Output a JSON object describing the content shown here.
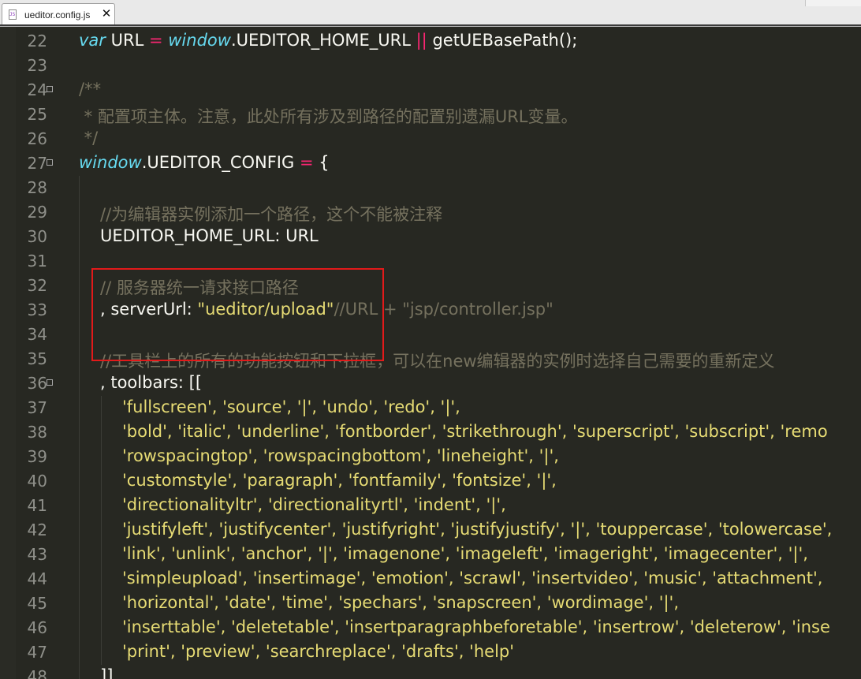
{
  "tab": {
    "title": "ueditor.config.js",
    "file_icon": "js-file-icon",
    "close_glyph": "✕"
  },
  "colors": {
    "background": "#272822",
    "keyword": "#66d9ef",
    "operator": "#f92672",
    "comment": "#75715e",
    "string": "#e6db74",
    "highlight_box": "#e21a1a"
  },
  "lines": [
    {
      "n": "22",
      "indent": 0,
      "tokens": [
        {
          "t": "var",
          "c": "kw"
        },
        {
          "t": " URL ",
          "c": "plain"
        },
        {
          "t": "=",
          "c": "op"
        },
        {
          "t": " ",
          "c": "plain"
        },
        {
          "t": "window",
          "c": "kw"
        },
        {
          "t": ".UEDITOR_HOME_URL ",
          "c": "plain"
        },
        {
          "t": "||",
          "c": "op"
        },
        {
          "t": " getUEBasePath();",
          "c": "plain"
        }
      ]
    },
    {
      "n": "23",
      "indent": 0,
      "tokens": []
    },
    {
      "n": "24",
      "indent": 0,
      "fold": true,
      "tokens": [
        {
          "t": "/**",
          "c": "cm"
        }
      ]
    },
    {
      "n": "25",
      "indent": 0,
      "tokens": [
        {
          "t": " * 配置项主体。注意，此处所有涉及到路径的配置别遗漏URL变量。",
          "c": "cm"
        }
      ]
    },
    {
      "n": "26",
      "indent": 0,
      "tokens": [
        {
          "t": " */",
          "c": "cm"
        }
      ]
    },
    {
      "n": "27",
      "indent": 0,
      "fold": true,
      "tokens": [
        {
          "t": "window",
          "c": "kw"
        },
        {
          "t": ".UEDITOR_CONFIG ",
          "c": "plain"
        },
        {
          "t": "=",
          "c": "op"
        },
        {
          "t": " {",
          "c": "plain"
        }
      ]
    },
    {
      "n": "28",
      "indent": 1,
      "tokens": []
    },
    {
      "n": "29",
      "indent": 1,
      "tokens": [
        {
          "t": "//为编辑器实例添加一个路径，这个不能被注释",
          "c": "cm"
        }
      ]
    },
    {
      "n": "30",
      "indent": 1,
      "tokens": [
        {
          "t": "UEDITOR_HOME_URL: URL",
          "c": "plain"
        }
      ]
    },
    {
      "n": "31",
      "indent": 1,
      "tokens": []
    },
    {
      "n": "32",
      "indent": 1,
      "tokens": [
        {
          "t": "// 服务器统一请求接口路径",
          "c": "cm"
        }
      ]
    },
    {
      "n": "33",
      "indent": 1,
      "tokens": [
        {
          "t": ", serverUrl: ",
          "c": "plain"
        },
        {
          "t": "\"ueditor/upload\"",
          "c": "str"
        },
        {
          "t": "//URL + \"jsp/controller.jsp\"",
          "c": "cm"
        }
      ]
    },
    {
      "n": "34",
      "indent": 1,
      "tokens": []
    },
    {
      "n": "35",
      "indent": 1,
      "tokens": [
        {
          "t": "//工具栏上的所有的功能按钮和下拉框，可以在new编辑器的实例时选择自己需要的重新定义",
          "c": "cm"
        }
      ]
    },
    {
      "n": "36",
      "indent": 1,
      "fold": true,
      "tokens": [
        {
          "t": ", toolbars: [[",
          "c": "plain"
        }
      ]
    },
    {
      "n": "37",
      "indent": 2,
      "tokens": [
        {
          "t": "'fullscreen', 'source', '|', 'undo', 'redo', '|',",
          "c": "str"
        }
      ]
    },
    {
      "n": "38",
      "indent": 2,
      "tokens": [
        {
          "t": "'bold', 'italic', 'underline', 'fontborder', 'strikethrough', 'superscript', 'subscript', 'remo",
          "c": "str"
        }
      ]
    },
    {
      "n": "39",
      "indent": 2,
      "tokens": [
        {
          "t": "'rowspacingtop', 'rowspacingbottom', 'lineheight', '|',",
          "c": "str"
        }
      ]
    },
    {
      "n": "40",
      "indent": 2,
      "tokens": [
        {
          "t": "'customstyle', 'paragraph', 'fontfamily', 'fontsize', '|',",
          "c": "str"
        }
      ]
    },
    {
      "n": "41",
      "indent": 2,
      "tokens": [
        {
          "t": "'directionalityltr', 'directionalityrtl', 'indent', '|',",
          "c": "str"
        }
      ]
    },
    {
      "n": "42",
      "indent": 2,
      "tokens": [
        {
          "t": "'justifyleft', 'justifycenter', 'justifyright', 'justifyjustify', '|', 'touppercase', 'tolowercase',",
          "c": "str"
        }
      ]
    },
    {
      "n": "43",
      "indent": 2,
      "tokens": [
        {
          "t": "'link', 'unlink', 'anchor', '|', 'imagenone', 'imageleft', 'imageright', 'imagecenter', '|',",
          "c": "str"
        }
      ]
    },
    {
      "n": "44",
      "indent": 2,
      "tokens": [
        {
          "t": "'simpleupload', 'insertimage', 'emotion', 'scrawl', 'insertvideo', 'music', 'attachment',",
          "c": "str"
        }
      ]
    },
    {
      "n": "45",
      "indent": 2,
      "tokens": [
        {
          "t": "'horizontal', 'date', 'time', 'spechars', 'snapscreen', 'wordimage', '|',",
          "c": "str"
        }
      ]
    },
    {
      "n": "46",
      "indent": 2,
      "tokens": [
        {
          "t": "'inserttable', 'deletetable', 'insertparagraphbeforetable', 'insertrow', 'deleterow', 'inse",
          "c": "str"
        }
      ]
    },
    {
      "n": "47",
      "indent": 2,
      "tokens": [
        {
          "t": "'print', 'preview', 'searchreplace', 'drafts', 'help'",
          "c": "str"
        }
      ]
    },
    {
      "n": "48",
      "indent": 1,
      "tokens": [
        {
          "t": "]]",
          "c": "plain"
        }
      ]
    }
  ]
}
